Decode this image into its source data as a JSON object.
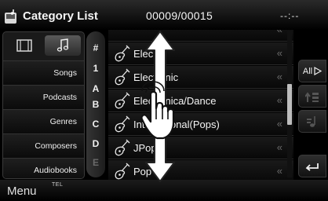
{
  "header": {
    "title": "Category List",
    "track_counter": "00009/00015",
    "clock": "--:--",
    "icon": "music-device-icon"
  },
  "media_tabs": [
    {
      "name": "video-tab",
      "icon": "film-icon",
      "selected": false
    },
    {
      "name": "music-tab",
      "icon": "music-note-icon",
      "selected": true
    }
  ],
  "categories": [
    {
      "label": "Songs"
    },
    {
      "label": "Podcasts"
    },
    {
      "label": "Genres"
    },
    {
      "label": "Composers"
    },
    {
      "label": "Audiobooks"
    }
  ],
  "alphabet": [
    "#",
    "1",
    "A",
    "B",
    "C",
    "D",
    "E"
  ],
  "list": {
    "items": [
      {
        "label": "",
        "icon": "guitar-icon"
      },
      {
        "label": "Elec",
        "icon": "guitar-icon"
      },
      {
        "label": "Electronic",
        "icon": "guitar-icon"
      },
      {
        "label": "Electronica/Dance",
        "icon": "guitar-icon"
      },
      {
        "label": "International(Pops)",
        "icon": "guitar-icon"
      },
      {
        "label": "JPop",
        "icon": "guitar-icon"
      },
      {
        "label": "Pop",
        "icon": "guitar-icon"
      }
    ],
    "chevron": "«"
  },
  "scrollbar": {
    "position_fraction": 0.5,
    "thumb_fraction": 0.28
  },
  "side_buttons": {
    "all_label": "All",
    "all_icon": "play-right-icon",
    "up_icon": "up-level-icon",
    "top_icon": "top-list-icon",
    "return_icon": "return-icon"
  },
  "bottom": {
    "menu_label": "Menu",
    "tel_label": "TEL"
  },
  "gesture": {
    "icons": [
      "touch-hand-icon",
      "vertical-drag-arrow-icon"
    ]
  },
  "colors": {
    "background": "#000000",
    "text": "#ffffff",
    "chevron": "#6a6a6a",
    "divider": "#2a2a2a"
  }
}
